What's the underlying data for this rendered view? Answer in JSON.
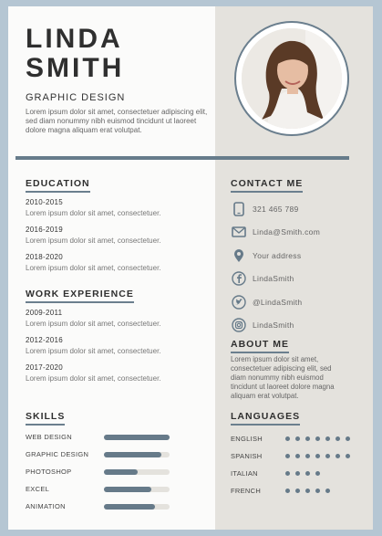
{
  "header": {
    "first_name": "LINDA",
    "last_name": "SMITH",
    "role": "GRAPHIC DESIGN",
    "intro": "Lorem ipsum dolor sit amet, consectetuer adipiscing elit, sed diam nonummy nibh euismod tincidunt ut laoreet dolore magna aliquam erat volutpat."
  },
  "education": {
    "title": "EDUCATION",
    "items": [
      {
        "years": "2010-2015",
        "text": "Lorem ipsum dolor sit amet, consectetuer."
      },
      {
        "years": "2016-2019",
        "text": "Lorem ipsum dolor sit amet, consectetuer."
      },
      {
        "years": "2018-2020",
        "text": "Lorem ipsum dolor sit amet, consectetuer."
      }
    ]
  },
  "work": {
    "title": "WORK EXPERIENCE",
    "items": [
      {
        "years": "2009-2011",
        "text": "Lorem ipsum dolor sit amet, consectetuer."
      },
      {
        "years": "2012-2016",
        "text": "Lorem ipsum dolor sit amet, consectetuer."
      },
      {
        "years": "2017-2020",
        "text": "Lorem ipsum dolor sit amet, consectetuer."
      }
    ]
  },
  "skills": {
    "title": "SKILLS",
    "items": [
      {
        "label": "WEB DESIGN",
        "level": 1.0
      },
      {
        "label": "GRAPHIC DESIGN",
        "level": 0.88
      },
      {
        "label": "PHOTOSHOP",
        "level": 0.52
      },
      {
        "label": "EXCEL",
        "level": 0.72
      },
      {
        "label": "ANIMATION",
        "level": 0.78
      }
    ]
  },
  "contact": {
    "title": "CONTACT ME",
    "items": [
      {
        "icon": "phone-icon",
        "text": "321 465 789"
      },
      {
        "icon": "mail-icon",
        "text": "Linda@Smith.com"
      },
      {
        "icon": "location-pin-icon",
        "text": "Your address"
      },
      {
        "icon": "facebook-icon",
        "text": "LindaSmith"
      },
      {
        "icon": "twitter-icon",
        "text": "@LindaSmith"
      },
      {
        "icon": "instagram-icon",
        "text": "LindaSmith"
      }
    ]
  },
  "about": {
    "title": "ABOUT ME",
    "text": "Lorem ipsum dolor sit amet, consectetuer adipiscing elit, sed diam nonummy nibh euismod tincidunt ut laoreet dolore magna aliquam erat volutpat."
  },
  "languages": {
    "title": "LANGUAGES",
    "items": [
      {
        "label": "ENGLISH",
        "dots": 7
      },
      {
        "label": "SPANISH",
        "dots": 7
      },
      {
        "label": "ITALIAN",
        "dots": 4
      },
      {
        "label": "FRENCH",
        "dots": 5
      }
    ]
  },
  "colors": {
    "accent": "#667a89",
    "background": "#b5c6d3",
    "right_column": "#e4e2dd"
  }
}
